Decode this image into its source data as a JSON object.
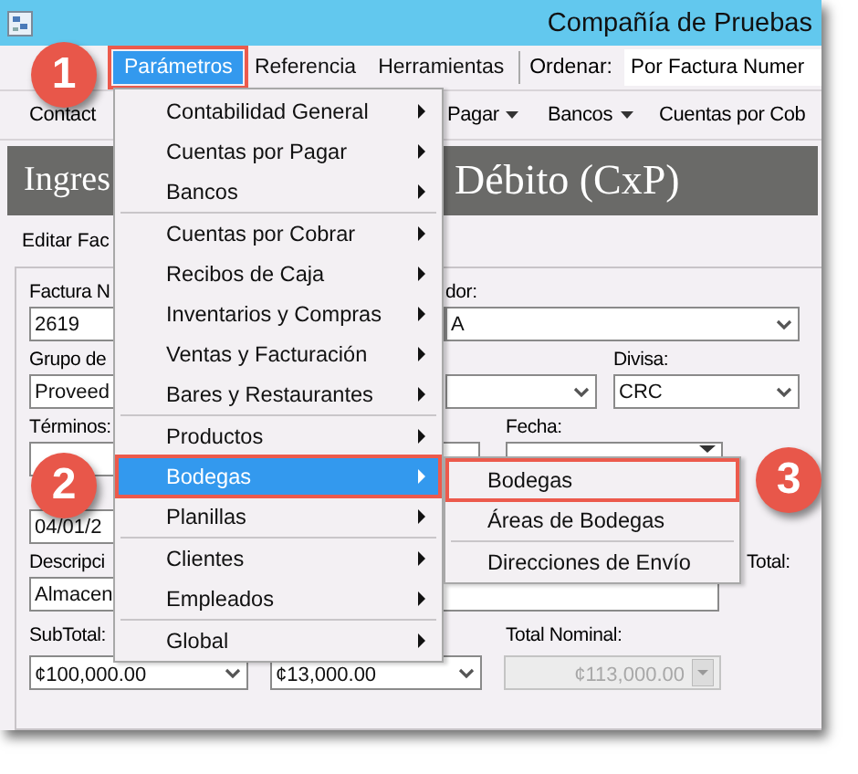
{
  "window": {
    "title": "Compañía de Pruebas"
  },
  "menubar": {
    "items": [
      {
        "label": "Parámetros",
        "selected": true
      },
      {
        "label": "Referencia",
        "selected": false
      },
      {
        "label": "Herramientas",
        "selected": false
      }
    ],
    "sort": {
      "label": "Ordenar:",
      "value": "Por Factura Numer"
    }
  },
  "toolbar": [
    {
      "label": "Contact",
      "kind": "button"
    },
    {
      "label": "Pagar",
      "kind": "dropdown"
    },
    {
      "label": "Bancos",
      "kind": "dropdown"
    },
    {
      "label": "Cuentas por Cob",
      "kind": "button"
    }
  ],
  "header": {
    "left": "Ingres",
    "right": "Débito (CxP)"
  },
  "tab": "Editar Fac",
  "form": {
    "rows": [
      {
        "labels": [
          "Factura N",
          "dor:"
        ],
        "fields": [
          {
            "kind": "text",
            "value": "2619"
          },
          {
            "kind": "combo",
            "value": "A"
          }
        ]
      },
      {
        "labels": [
          "Grupo de",
          "Divisa:"
        ],
        "fields": [
          {
            "kind": "text",
            "value": "Proveed"
          },
          {
            "kind": "combo"
          },
          {
            "kind": "combo",
            "value": "CRC"
          }
        ]
      },
      {
        "labels": [
          "Términos:",
          "Fecha:"
        ],
        "fields": [
          {
            "kind": "text"
          },
          {
            "kind": "date"
          }
        ]
      },
      {
        "labels": [],
        "fields": [
          {
            "kind": "text",
            "value": "04/01/2"
          }
        ]
      },
      {
        "labels": [
          "Descripci",
          "Total:"
        ],
        "fields": [
          {
            "kind": "text",
            "value": "Almacen"
          }
        ]
      },
      {
        "labels": [
          "SubTotal:",
          "Total Nominal:"
        ],
        "fields": [
          {
            "kind": "amount",
            "value": "¢100,000.00",
            "disabled": false
          },
          {
            "kind": "amount",
            "value": "¢13,000.00",
            "disabled": false
          },
          {
            "kind": "amount",
            "value": "¢113,000.00",
            "disabled": true
          }
        ]
      }
    ]
  },
  "menu": {
    "items": [
      {
        "kind": "item",
        "label": "Contabilidad General",
        "selected": false
      },
      {
        "kind": "item",
        "label": "Cuentas por Pagar",
        "selected": false
      },
      {
        "kind": "item",
        "label": "Bancos",
        "selected": false
      },
      {
        "kind": "separator"
      },
      {
        "kind": "item",
        "label": "Cuentas por Cobrar",
        "selected": false
      },
      {
        "kind": "item",
        "label": "Recibos de Caja",
        "selected": false
      },
      {
        "kind": "item",
        "label": "Inventarios y Compras",
        "selected": false
      },
      {
        "kind": "item",
        "label": "Ventas y Facturación",
        "selected": false
      },
      {
        "kind": "item",
        "label": "Bares y Restaurantes",
        "selected": false
      },
      {
        "kind": "separator"
      },
      {
        "kind": "item",
        "label": "Productos",
        "selected": false
      },
      {
        "kind": "item",
        "label": "Bodegas",
        "selected": true
      },
      {
        "kind": "item",
        "label": "Planillas",
        "selected": false
      },
      {
        "kind": "separator"
      },
      {
        "kind": "item",
        "label": "Clientes",
        "selected": false
      },
      {
        "kind": "item",
        "label": "Empleados",
        "selected": false
      },
      {
        "kind": "separator"
      },
      {
        "kind": "item",
        "label": "Global",
        "selected": false
      }
    ]
  },
  "submenu": {
    "items": [
      {
        "kind": "item",
        "label": "Bodegas",
        "selected": true
      },
      {
        "kind": "item",
        "label": "Áreas de Bodegas",
        "selected": false
      },
      {
        "kind": "separator"
      },
      {
        "kind": "item",
        "label": "Direcciones de Envío",
        "selected": false
      }
    ]
  },
  "callouts": [
    "1",
    "2",
    "3"
  ]
}
